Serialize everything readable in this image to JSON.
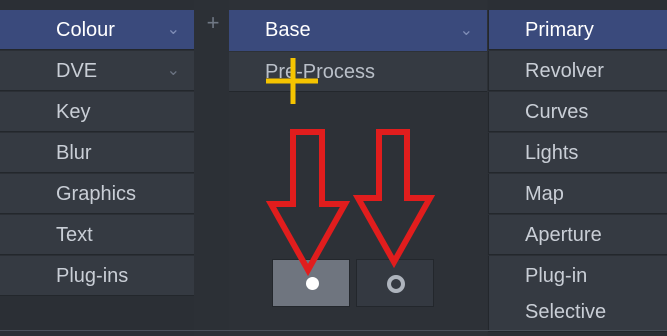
{
  "left_panel": {
    "items": [
      {
        "label": "Colour",
        "active": true,
        "dropdown": true
      },
      {
        "label": "DVE",
        "active": false,
        "dropdown": true
      },
      {
        "label": "Key",
        "active": false,
        "dropdown": false
      },
      {
        "label": "Blur",
        "active": false,
        "dropdown": false
      },
      {
        "label": "Graphics",
        "active": false,
        "dropdown": false
      },
      {
        "label": "Text",
        "active": false,
        "dropdown": false
      },
      {
        "label": "Plug-ins",
        "active": false,
        "dropdown": false
      }
    ]
  },
  "add_button": {
    "icon": "plus-icon",
    "glyph": "+"
  },
  "middle_panel": {
    "header": {
      "label": "Base",
      "dropdown": true
    },
    "items": [
      {
        "label": "Pre-Process"
      }
    ]
  },
  "right_panel": {
    "items": [
      {
        "label": "Primary",
        "active": true
      },
      {
        "label": "Revolver",
        "active": false
      },
      {
        "label": "Curves",
        "active": false
      },
      {
        "label": "Lights",
        "active": false
      },
      {
        "label": "Map",
        "active": false
      },
      {
        "label": "Aperture",
        "active": false
      },
      {
        "label": "Plug-in",
        "active": false
      },
      {
        "label": "Selective",
        "active": false
      }
    ]
  },
  "mode_buttons": [
    {
      "icon": "filled-dot-icon",
      "selected": true
    },
    {
      "icon": "ring-icon",
      "selected": false
    }
  ],
  "annotations": {
    "arrow_color": "#e11d1d",
    "cursor_color": "#f5c400",
    "cursor_icon": "crosshair-cursor-icon"
  },
  "colors": {
    "accent": "#3a4a7c",
    "panel": "#353a42",
    "background": "#2c3036"
  }
}
